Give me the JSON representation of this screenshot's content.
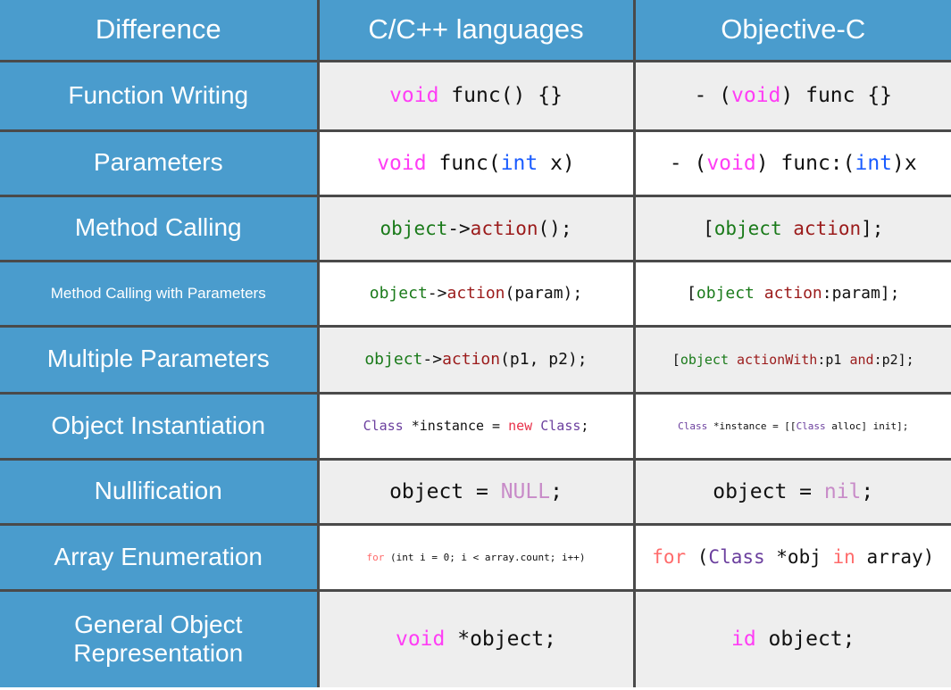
{
  "table": {
    "headers": [
      {
        "label": "Difference",
        "name": "header-difference"
      },
      {
        "label": "C/C++ languages",
        "name": "header-c-cpp"
      },
      {
        "label": "Objective-C",
        "name": "header-objective-c"
      }
    ],
    "rows": [
      {
        "label": "Function Writing",
        "c_code": "void func() {}",
        "objc_code": "- (void) func {}",
        "c_tokens": [
          {
            "t": "void",
            "c": "tok-keyword"
          },
          {
            "t": " func() {}",
            "c": "tok-plain"
          }
        ],
        "objc_tokens": [
          {
            "t": "- (",
            "c": "tok-plain"
          },
          {
            "t": "void",
            "c": "tok-keyword"
          },
          {
            "t": ") func {}",
            "c": "tok-plain"
          }
        ]
      },
      {
        "label": "Parameters",
        "c_code": "void func(int x)",
        "objc_code": "- (void) func:(int)x",
        "c_tokens": [
          {
            "t": "void",
            "c": "tok-keyword"
          },
          {
            "t": " func(",
            "c": "tok-plain"
          },
          {
            "t": "int",
            "c": "tok-type"
          },
          {
            "t": " x)",
            "c": "tok-plain"
          }
        ],
        "objc_tokens": [
          {
            "t": "- (",
            "c": "tok-plain"
          },
          {
            "t": "void",
            "c": "tok-keyword"
          },
          {
            "t": ") func:(",
            "c": "tok-plain"
          },
          {
            "t": "int",
            "c": "tok-type"
          },
          {
            "t": ")x",
            "c": "tok-plain"
          }
        ]
      },
      {
        "label": "Method Calling",
        "c_code": "object->action();",
        "objc_code": "[object action];",
        "c_tokens": [
          {
            "t": "object",
            "c": "tok-object"
          },
          {
            "t": "->",
            "c": "tok-plain"
          },
          {
            "t": "action",
            "c": "tok-action"
          },
          {
            "t": "();",
            "c": "tok-plain"
          }
        ],
        "objc_tokens": [
          {
            "t": "[",
            "c": "tok-plain"
          },
          {
            "t": "object",
            "c": "tok-object"
          },
          {
            "t": " ",
            "c": "tok-plain"
          },
          {
            "t": "action",
            "c": "tok-action"
          },
          {
            "t": "];",
            "c": "tok-plain"
          }
        ]
      },
      {
        "label": "Method Calling with Parameters",
        "c_code": "object->action(param);",
        "objc_code": "[object action:param];",
        "c_tokens": [
          {
            "t": "object",
            "c": "tok-object"
          },
          {
            "t": "->",
            "c": "tok-plain"
          },
          {
            "t": "action",
            "c": "tok-action"
          },
          {
            "t": "(param);",
            "c": "tok-plain"
          }
        ],
        "objc_tokens": [
          {
            "t": "[",
            "c": "tok-plain"
          },
          {
            "t": "object",
            "c": "tok-object"
          },
          {
            "t": " ",
            "c": "tok-plain"
          },
          {
            "t": "action",
            "c": "tok-action"
          },
          {
            "t": ":param];",
            "c": "tok-plain"
          }
        ]
      },
      {
        "label": "Multiple Parameters",
        "c_code": "object->action(p1, p2);",
        "objc_code": "[object actionWith:p1 and:p2];",
        "c_tokens": [
          {
            "t": "object",
            "c": "tok-object"
          },
          {
            "t": "->",
            "c": "tok-plain"
          },
          {
            "t": "action",
            "c": "tok-action"
          },
          {
            "t": "(p1, p2);",
            "c": "tok-plain"
          }
        ],
        "objc_tokens": [
          {
            "t": "[",
            "c": "tok-plain"
          },
          {
            "t": "object",
            "c": "tok-object"
          },
          {
            "t": " ",
            "c": "tok-plain"
          },
          {
            "t": "actionWith",
            "c": "tok-action"
          },
          {
            "t": ":p1 ",
            "c": "tok-plain"
          },
          {
            "t": "and",
            "c": "tok-action"
          },
          {
            "t": ":p2];",
            "c": "tok-plain"
          }
        ]
      },
      {
        "label": "Object Instantiation",
        "c_code": "Class *instance = new Class;",
        "objc_code": "Class *instance = [[Class alloc] init];",
        "c_tokens": [
          {
            "t": "Class",
            "c": "tok-class"
          },
          {
            "t": " *instance = ",
            "c": "tok-plain"
          },
          {
            "t": "new",
            "c": "tok-new"
          },
          {
            "t": " ",
            "c": "tok-plain"
          },
          {
            "t": "Class",
            "c": "tok-class"
          },
          {
            "t": ";",
            "c": "tok-plain"
          }
        ],
        "objc_tokens": [
          {
            "t": "Class",
            "c": "tok-class"
          },
          {
            "t": " *instance = [[",
            "c": "tok-plain"
          },
          {
            "t": "Class",
            "c": "tok-class"
          },
          {
            "t": " alloc] init];",
            "c": "tok-plain"
          }
        ]
      },
      {
        "label": "Nullification",
        "c_code": "object = NULL;",
        "objc_code": "object = nil;",
        "c_tokens": [
          {
            "t": "object = ",
            "c": "tok-plain"
          },
          {
            "t": "NULL",
            "c": "tok-null"
          },
          {
            "t": ";",
            "c": "tok-plain"
          }
        ],
        "objc_tokens": [
          {
            "t": "object = ",
            "c": "tok-plain"
          },
          {
            "t": "nil",
            "c": "tok-null"
          },
          {
            "t": ";",
            "c": "tok-plain"
          }
        ]
      },
      {
        "label": "Array Enumeration",
        "c_code": "for (int i = 0; i < array.count; i++)",
        "objc_code": "for (Class *obj in array)",
        "c_tokens": [
          {
            "t": "for",
            "c": "tok-flow"
          },
          {
            "t": " (int i = 0; i < array.count; i++)",
            "c": "tok-plain"
          }
        ],
        "objc_tokens": [
          {
            "t": "for",
            "c": "tok-flow"
          },
          {
            "t": " (",
            "c": "tok-plain"
          },
          {
            "t": "Class",
            "c": "tok-class"
          },
          {
            "t": " *obj ",
            "c": "tok-plain"
          },
          {
            "t": "in",
            "c": "tok-flow"
          },
          {
            "t": " array)",
            "c": "tok-plain"
          }
        ]
      },
      {
        "label": "General Object Representation",
        "c_code": "void *object;",
        "objc_code": "id object;",
        "c_tokens": [
          {
            "t": "void",
            "c": "tok-keyword"
          },
          {
            "t": " *object;",
            "c": "tok-plain"
          }
        ],
        "objc_tokens": [
          {
            "t": "id",
            "c": "tok-keyword"
          },
          {
            "t": " object;",
            "c": "tok-plain"
          }
        ]
      }
    ]
  },
  "style_meta": {
    "header_background": "#4a9ccd",
    "label_background": "#4a9ccd",
    "label_text_color": "#ffffff",
    "row_shade_gray": "#eeeeee",
    "row_shade_white": "#ffffff",
    "grid_line_color": "#4a4a4a"
  }
}
